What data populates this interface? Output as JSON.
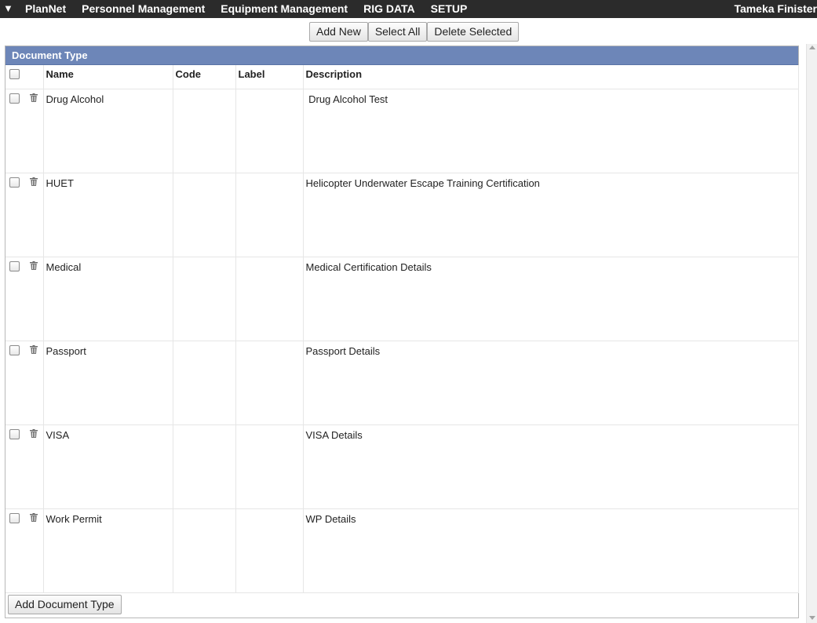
{
  "topbar": {
    "menu_toggle": "▼",
    "nav": [
      "PlanNet",
      "Personnel Management",
      "Equipment Management",
      "RIG DATA",
      "SETUP"
    ],
    "user_name": "Tameka Finister"
  },
  "toolbar": {
    "add_new_label": "Add New",
    "select_all_label": "Select All",
    "delete_selected_label": "Delete Selected"
  },
  "panel": {
    "title": "Document Type",
    "columns": {
      "name": "Name",
      "code": "Code",
      "label": "Label",
      "description": "Description"
    },
    "rows": [
      {
        "name": "Drug Alcohol",
        "code": "",
        "label": "",
        "description": " Drug Alcohol Test"
      },
      {
        "name": "HUET",
        "code": "",
        "label": "",
        "description": "Helicopter Underwater Escape Training Certification"
      },
      {
        "name": "Medical",
        "code": "",
        "label": "",
        "description": "Medical Certification Details"
      },
      {
        "name": "Passport",
        "code": "",
        "label": "",
        "description": "Passport Details"
      },
      {
        "name": "VISA",
        "code": "",
        "label": "",
        "description": "VISA Details"
      },
      {
        "name": "Work Permit",
        "code": "",
        "label": "",
        "description": "WP Details"
      }
    ],
    "add_button_label": "Add Document Type"
  },
  "icons": {
    "row_delete": "trash-icon",
    "menu_toggle": "triangle-down-icon"
  },
  "colors": {
    "topbar_bg": "#2b2b2b",
    "panel_header_bg": "#6d86b8"
  }
}
